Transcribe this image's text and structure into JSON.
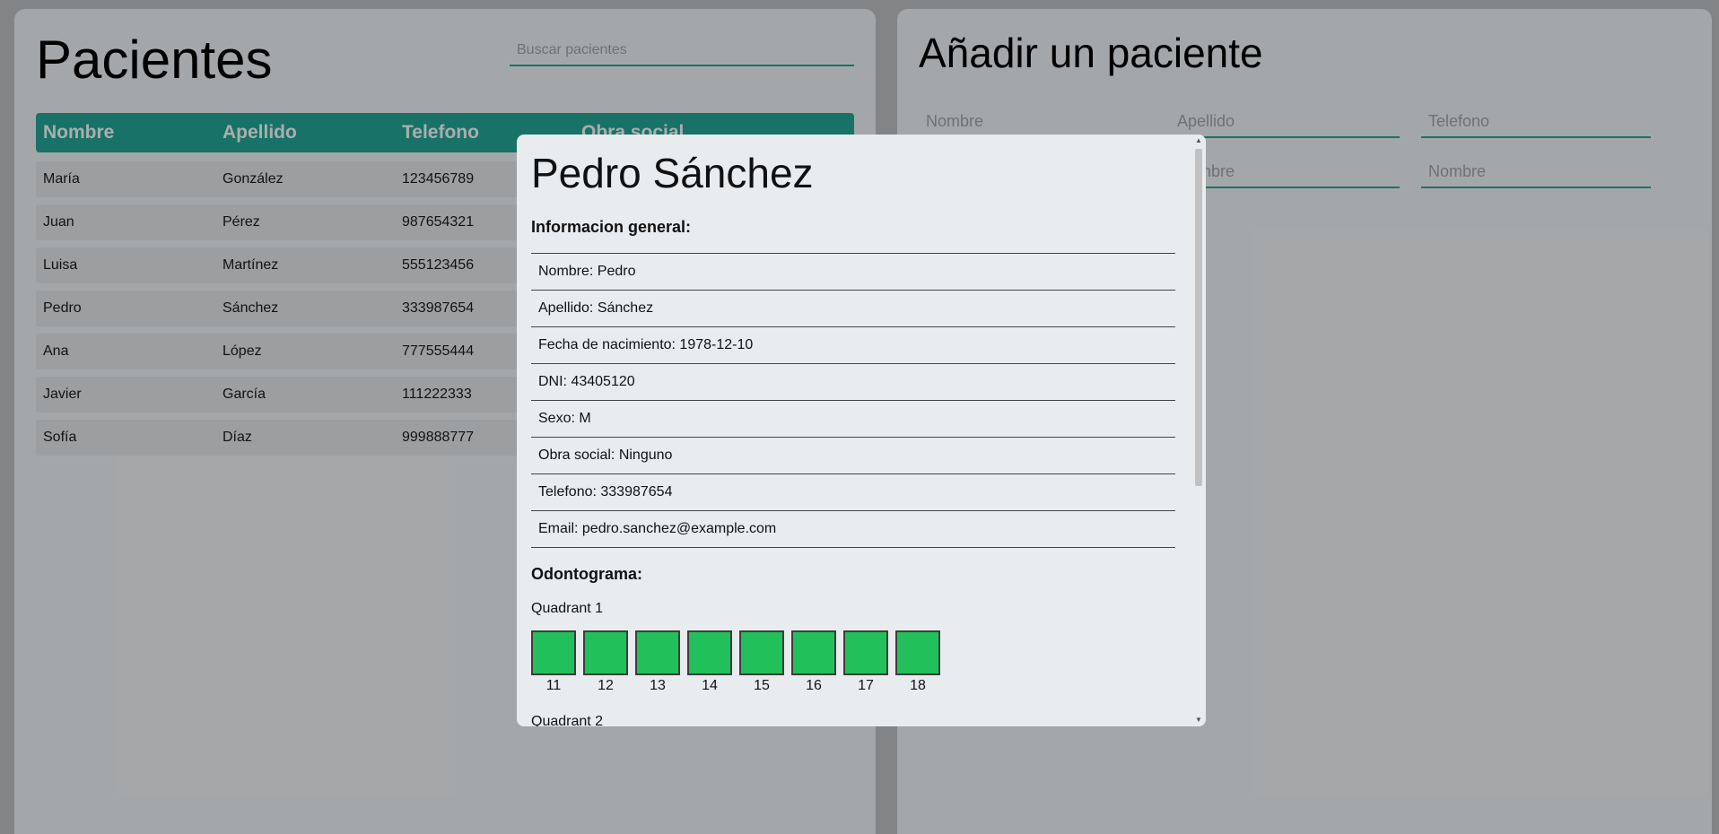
{
  "patients": {
    "title": "Pacientes",
    "search_placeholder": "Buscar pacientes",
    "columns": [
      "Nombre",
      "Apellido",
      "Telefono",
      "Obra social"
    ],
    "rows": [
      [
        "María",
        "González",
        "123456789"
      ],
      [
        "Juan",
        "Pérez",
        "987654321"
      ],
      [
        "Luisa",
        "Martínez",
        "555123456"
      ],
      [
        "Pedro",
        "Sánchez",
        "333987654"
      ],
      [
        "Ana",
        "López",
        "777555444"
      ],
      [
        "Javier",
        "García",
        "111222333"
      ],
      [
        "Sofía",
        "Díaz",
        "999888777"
      ]
    ]
  },
  "add_patient": {
    "title": "Añadir un paciente",
    "fields": [
      "Nombre",
      "Apellido",
      "Telefono",
      "Nombre",
      "Nombre",
      "Nombre"
    ]
  },
  "modal": {
    "title": "Pedro Sánchez",
    "general_heading": "Informacion general:",
    "info": [
      "Nombre: Pedro",
      "Apellido: Sánchez",
      "Fecha de nacimiento: 1978-12-10",
      "DNI: 43405120",
      "Sexo: M",
      "Obra social: Ninguno",
      "Telefono: 333987654",
      "Email: pedro.sanchez@example.com"
    ],
    "odontogram_heading": "Odontograma:",
    "quadrant1_label": "Quadrant 1",
    "quadrant1_teeth": [
      "11",
      "12",
      "13",
      "14",
      "15",
      "16",
      "17",
      "18"
    ],
    "quadrant2_label": "Quadrant 2",
    "tooth_color": "#22c05a",
    "accent_color": "#24a192"
  }
}
